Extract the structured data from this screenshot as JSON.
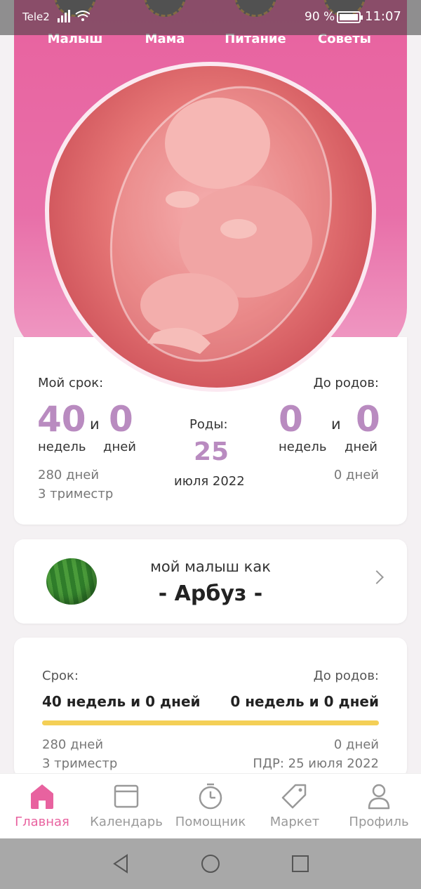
{
  "status_bar": {
    "carrier": "Tele2",
    "battery": "90 %",
    "time": "11:07"
  },
  "top_tabs": [
    {
      "label": "Малыш"
    },
    {
      "label": "Мама"
    },
    {
      "label": "Питание"
    },
    {
      "label": "Советы"
    }
  ],
  "pregnancy": {
    "my_term_label": "Мой срок:",
    "to_birth_label": "До родов:",
    "weeks": "40",
    "and": "и",
    "days": "0",
    "weeks_unit": "недель",
    "days_unit": "дней",
    "total_days": "280 дней",
    "trimester": "3 триместр",
    "birth_label": "Роды:",
    "birth_day": "25",
    "birth_month_year": "июля 2022",
    "left_weeks": "0",
    "left_days": "0",
    "left_total_days": "0 дней"
  },
  "baby": {
    "like_text": "мой малыш как",
    "fruit": "- Арбуз -"
  },
  "progress": {
    "term_label": "Срок:",
    "to_birth_label": "До родов:",
    "term_value": "40 недель и 0 дней",
    "left_value": "0 недель и 0 дней",
    "progress_fraction": 1.0,
    "total_days": "280 дней",
    "trimester": "3 триместр",
    "left_days": "0 дней",
    "due_date": "ПДР: 25 июля 2022",
    "bar_color": "#f4cf56"
  },
  "bottom_nav": [
    {
      "label": "Главная",
      "icon": "home-icon",
      "active": true
    },
    {
      "label": "Календарь",
      "icon": "calendar-icon"
    },
    {
      "label": "Помощник",
      "icon": "timer-icon"
    },
    {
      "label": "Маркет",
      "icon": "tag-icon"
    },
    {
      "label": "Профиль",
      "icon": "profile-icon"
    }
  ],
  "colors": {
    "accent": "#e8629f",
    "number": "#b98bc0"
  }
}
